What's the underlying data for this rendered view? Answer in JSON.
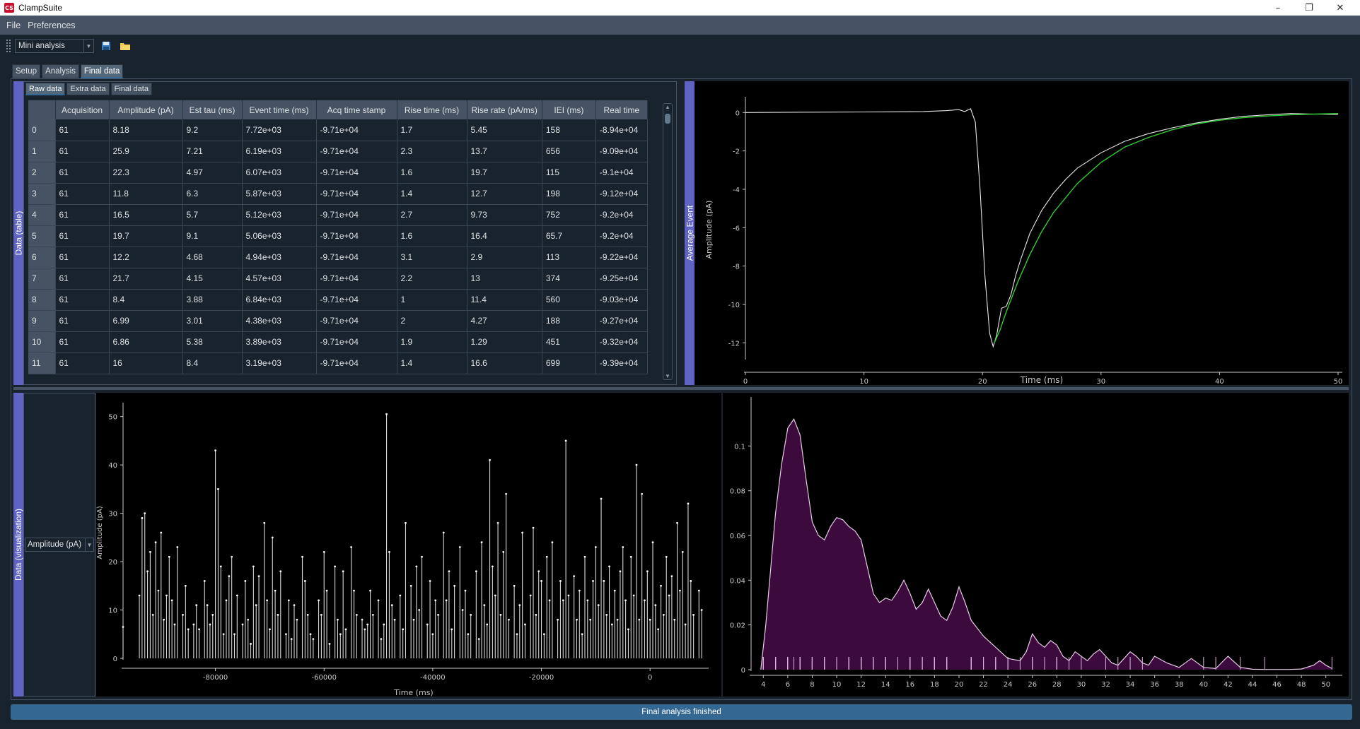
{
  "window": {
    "app_icon": "CS",
    "title": "ClampSuite",
    "minimize": "–",
    "maximize": "❐",
    "close": "✕"
  },
  "menu": [
    "File",
    "Preferences"
  ],
  "toolbar": {
    "analysis_value": "Mini analysis",
    "save_icon": "save-icon",
    "open_icon": "folder-icon"
  },
  "outer_tabs": [
    "Setup",
    "Analysis",
    "Final data"
  ],
  "inner_tabs": [
    "Raw data",
    "Extra data",
    "Final data"
  ],
  "panels": {
    "data_table_label": "Data (table)",
    "avg_event_label": "Average Event",
    "data_viz_label": "Data (visualization)"
  },
  "table": {
    "columns": [
      "Acquisition",
      "Amplitude (pA)",
      "Est tau (ms)",
      "Event time (ms)",
      "Acq time stamp",
      "Rise time (ms)",
      "Rise rate (pA/ms)",
      "IEI (ms)",
      "Real time"
    ],
    "rows": [
      [
        "0",
        "61",
        "8.18",
        "9.2",
        "7.72e+03",
        "-9.71e+04",
        "1.7",
        "5.45",
        "158",
        "-8.94e+04"
      ],
      [
        "1",
        "61",
        "25.9",
        "7.21",
        "6.19e+03",
        "-9.71e+04",
        "2.3",
        "13.7",
        "656",
        "-9.09e+04"
      ],
      [
        "2",
        "61",
        "22.3",
        "4.97",
        "6.07e+03",
        "-9.71e+04",
        "1.6",
        "19.7",
        "115",
        "-9.1e+04"
      ],
      [
        "3",
        "61",
        "11.8",
        "6.3",
        "5.87e+03",
        "-9.71e+04",
        "1.4",
        "12.7",
        "198",
        "-9.12e+04"
      ],
      [
        "4",
        "61",
        "16.5",
        "5.7",
        "5.12e+03",
        "-9.71e+04",
        "2.7",
        "9.73",
        "752",
        "-9.2e+04"
      ],
      [
        "5",
        "61",
        "19.7",
        "9.1",
        "5.06e+03",
        "-9.71e+04",
        "1.6",
        "16.4",
        "65.7",
        "-9.2e+04"
      ],
      [
        "6",
        "61",
        "12.2",
        "4.68",
        "4.94e+03",
        "-9.71e+04",
        "3.1",
        "2.9",
        "113",
        "-9.22e+04"
      ],
      [
        "7",
        "61",
        "21.7",
        "4.15",
        "4.57e+03",
        "-9.71e+04",
        "2.2",
        "13",
        "374",
        "-9.25e+04"
      ],
      [
        "8",
        "61",
        "8.4",
        "3.88",
        "6.84e+03",
        "-9.71e+04",
        "1",
        "11.4",
        "560",
        "-9.03e+04"
      ],
      [
        "9",
        "61",
        "6.99",
        "3.01",
        "4.38e+03",
        "-9.71e+04",
        "2",
        "4.27",
        "188",
        "-9.27e+04"
      ],
      [
        "10",
        "61",
        "6.86",
        "5.38",
        "3.89e+03",
        "-9.71e+04",
        "1.9",
        "1.29",
        "451",
        "-9.32e+04"
      ],
      [
        "11",
        "61",
        "16",
        "8.4",
        "3.19e+03",
        "-9.71e+04",
        "1.4",
        "16.6",
        "699",
        "-9.39e+04"
      ]
    ]
  },
  "viz_select_value": "Amplitude (pA)",
  "status": "Final analysis finished",
  "colors": {
    "trace": "#e6e6e6",
    "fit": "#33cc33",
    "kde_fill": "#3d0a3d",
    "kde_line": "#e6cce6",
    "rug": "#d9b3d9",
    "accent": "#5f64c4"
  },
  "chart_data": [
    {
      "type": "line",
      "name": "average-event",
      "xlabel": "Time (ms)",
      "ylabel": "Amplitude (pA)",
      "xlim": [
        0,
        50
      ],
      "ylim": [
        -12.8,
        0.6
      ],
      "xticks": [
        0,
        10,
        20,
        30,
        40,
        50
      ],
      "yticks": [
        0,
        -2,
        -4,
        -6,
        -8,
        -10,
        -12
      ],
      "series": [
        {
          "x": [
            0,
            5,
            10,
            15,
            17,
            18,
            18.5,
            19,
            19.4,
            19.8,
            20.2,
            20.6,
            20.9,
            21.2,
            21.6,
            22,
            22.4,
            22.8,
            23.2,
            24,
            25,
            26,
            27,
            28,
            30,
            32,
            34,
            36,
            38,
            40,
            42,
            44,
            46,
            48,
            49.5,
            50
          ],
          "y": [
            0,
            0.02,
            0.03,
            0.05,
            0.1,
            0.15,
            0.05,
            0.2,
            -0.5,
            -4,
            -8.5,
            -11.5,
            -12.2,
            -11.6,
            -10.2,
            -10.1,
            -9.5,
            -8.5,
            -7.7,
            -6.3,
            -5.1,
            -4.2,
            -3.5,
            -2.9,
            -2.1,
            -1.5,
            -1.1,
            -0.8,
            -0.55,
            -0.35,
            -0.2,
            -0.12,
            -0.05,
            -0.08,
            -0.1,
            -0.1
          ]
        },
        {
          "x": [
            21,
            21.5,
            22,
            22.5,
            23,
            24,
            25,
            26,
            28,
            30,
            32,
            34,
            36,
            38,
            40,
            42,
            44,
            46,
            48,
            50
          ],
          "y": [
            -12,
            -11.3,
            -10.4,
            -9.6,
            -8.8,
            -7.4,
            -6.2,
            -5.2,
            -3.7,
            -2.6,
            -1.8,
            -1.3,
            -0.9,
            -0.6,
            -0.4,
            -0.27,
            -0.18,
            -0.12,
            -0.08,
            -0.05
          ]
        }
      ]
    },
    {
      "type": "scatter",
      "name": "amplitude-vs-time",
      "xlabel": "Time (ms)",
      "ylabel": "Amplitude (pA)",
      "xlim": [
        -97000,
        10000
      ],
      "ylim": [
        0,
        52
      ],
      "xticks": [
        -80000,
        -60000,
        -40000,
        -20000,
        0
      ],
      "yticks": [
        0,
        10,
        20,
        30,
        40,
        50
      ],
      "x": [
        -97000,
        -94000,
        -93500,
        -93000,
        -92500,
        -92000,
        -91500,
        -91000,
        -90500,
        -90000,
        -89500,
        -89000,
        -88500,
        -88000,
        -87500,
        -87000,
        -86000,
        -85500,
        -85000,
        -84000,
        -83500,
        -83000,
        -82000,
        -81500,
        -81000,
        -80500,
        -80000,
        -79500,
        -79000,
        -78500,
        -78000,
        -77500,
        -77000,
        -76500,
        -76000,
        -75000,
        -74500,
        -74000,
        -73500,
        -73000,
        -72500,
        -72000,
        -71000,
        -70500,
        -70000,
        -69500,
        -69000,
        -68500,
        -68000,
        -67000,
        -66500,
        -66000,
        -65500,
        -65000,
        -64000,
        -63500,
        -63000,
        -62500,
        -62000,
        -61000,
        -60500,
        -60000,
        -59500,
        -59000,
        -58000,
        -57500,
        -57000,
        -56500,
        -56000,
        -55000,
        -54500,
        -54000,
        -53000,
        -52500,
        -52000,
        -51500,
        -51000,
        -50000,
        -49500,
        -49000,
        -48500,
        -48000,
        -47500,
        -47000,
        -46000,
        -45500,
        -45000,
        -44000,
        -43500,
        -43000,
        -42500,
        -42000,
        -41000,
        -40500,
        -40000,
        -39500,
        -39000,
        -38000,
        -37500,
        -37000,
        -36500,
        -36000,
        -35000,
        -34500,
        -34000,
        -33500,
        -33000,
        -32000,
        -31500,
        -31000,
        -30500,
        -30000,
        -29500,
        -29000,
        -28500,
        -28000,
        -27500,
        -27000,
        -26500,
        -26000,
        -25000,
        -24500,
        -24000,
        -23500,
        -23000,
        -22000,
        -21500,
        -21000,
        -20500,
        -20000,
        -19500,
        -19000,
        -18500,
        -18000,
        -17000,
        -16500,
        -16000,
        -15500,
        -15000,
        -14000,
        -13500,
        -13000,
        -12500,
        -12000,
        -11500,
        -11000,
        -10500,
        -10000,
        -9500,
        -9000,
        -8500,
        -8000,
        -7500,
        -7000,
        -6500,
        -6000,
        -5500,
        -5000,
        -4500,
        -4000,
        -3500,
        -3000,
        -2500,
        -2000,
        -1500,
        -1000,
        -500,
        0,
        500,
        1000,
        1500,
        2000,
        2500,
        3000,
        3500,
        4000,
        4500,
        5000,
        5500,
        6000,
        6500,
        7000,
        7500,
        8000,
        9000,
        9500
      ],
      "y": [
        6.5,
        13,
        29,
        30,
        18,
        22,
        9,
        24,
        14,
        26,
        8,
        13,
        21,
        12,
        7,
        23,
        9,
        15,
        6,
        7,
        11,
        6,
        16,
        11,
        7,
        9,
        43,
        35,
        19,
        5,
        12,
        17,
        21,
        5,
        13,
        7,
        16,
        8,
        3,
        19,
        11,
        17,
        28,
        12,
        6,
        25,
        14,
        9,
        18,
        5,
        12,
        4,
        11,
        8,
        21,
        16,
        9,
        5,
        4,
        12,
        9,
        22,
        14,
        3,
        19,
        8,
        5,
        18,
        6,
        23,
        14,
        9,
        8,
        6,
        7,
        14,
        9,
        12,
        4,
        7,
        50.5,
        22,
        11,
        8,
        13,
        6,
        28,
        15,
        8,
        19,
        10,
        21,
        7,
        16,
        5,
        12,
        9,
        26,
        12,
        18,
        6,
        15,
        23,
        10,
        14,
        5,
        9,
        18,
        4,
        24,
        11,
        7,
        41,
        19,
        13,
        28,
        9,
        22,
        34,
        8,
        15,
        5,
        11,
        26,
        7,
        13,
        27,
        9,
        18,
        16,
        5,
        21,
        12,
        24,
        8,
        16,
        12,
        45,
        13,
        17,
        8,
        14,
        5,
        21,
        12,
        8,
        16,
        23,
        11,
        33,
        16,
        9,
        19,
        7,
        14,
        8,
        18,
        23,
        12,
        6,
        21,
        13,
        40,
        8,
        34,
        12,
        18,
        8,
        24,
        11,
        6,
        15,
        9,
        21,
        13,
        17,
        8,
        28,
        14,
        22,
        7,
        32,
        16,
        9,
        14,
        10
      ]
    },
    {
      "type": "area",
      "name": "amplitude-kde",
      "xlim": [
        3,
        51
      ],
      "ylim": [
        0,
        0.12
      ],
      "xticks": [
        4,
        6,
        8,
        10,
        12,
        14,
        16,
        18,
        20,
        22,
        24,
        26,
        28,
        30,
        32,
        34,
        36,
        38,
        40,
        42,
        44,
        46,
        48,
        50
      ],
      "yticks": [
        0,
        0.02,
        0.04,
        0.06,
        0.08,
        0.1
      ],
      "x": [
        3.8,
        4.2,
        4.6,
        5,
        5.5,
        6,
        6.5,
        7,
        7.5,
        8,
        8.5,
        9,
        9.5,
        10,
        10.5,
        11,
        11.5,
        12,
        12.5,
        13,
        13.5,
        14,
        14.5,
        15,
        15.5,
        16,
        16.5,
        17,
        17.5,
        18,
        18.5,
        19,
        19.5,
        20,
        20.5,
        21,
        22,
        23,
        24,
        25,
        25.5,
        26,
        26.5,
        27,
        27.5,
        28,
        28.5,
        29,
        29.5,
        30,
        30.5,
        31,
        31.5,
        32,
        32.5,
        33,
        33.5,
        34,
        34.5,
        35,
        35.5,
        36,
        37,
        38,
        39,
        40,
        41,
        42,
        43,
        44,
        45,
        46,
        47,
        48,
        49,
        49.5,
        50,
        50.5
      ],
      "y": [
        0,
        0.02,
        0.045,
        0.07,
        0.092,
        0.108,
        0.112,
        0.105,
        0.085,
        0.066,
        0.06,
        0.058,
        0.064,
        0.068,
        0.067,
        0.064,
        0.062,
        0.058,
        0.046,
        0.034,
        0.03,
        0.032,
        0.031,
        0.035,
        0.04,
        0.034,
        0.027,
        0.03,
        0.036,
        0.03,
        0.024,
        0.022,
        0.028,
        0.037,
        0.03,
        0.022,
        0.015,
        0.01,
        0.005,
        0.004,
        0.008,
        0.016,
        0.012,
        0.01,
        0.013,
        0.011,
        0.006,
        0.004,
        0.008,
        0.006,
        0.004,
        0.007,
        0.009,
        0.006,
        0.003,
        0.002,
        0.005,
        0.008,
        0.006,
        0.003,
        0.002,
        0.006,
        0.003,
        0.001,
        0.005,
        0.001,
        0.0005,
        0.006,
        0.001,
        0.0002,
        0.0001,
        0.0001,
        0.0001,
        0.0003,
        0.002,
        0.004,
        0.002,
        0.0005
      ]
    }
  ]
}
